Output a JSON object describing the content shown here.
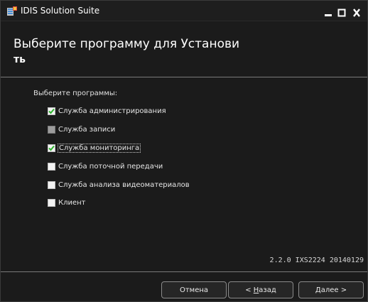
{
  "window": {
    "title": "IDIS Solution Suite",
    "controls": {
      "minimize": "minimize-icon",
      "maximize": "maximize-icon",
      "close": "close-icon"
    }
  },
  "header": {
    "line1": "Выберите программу для Установи",
    "line2": "ть"
  },
  "programs": {
    "label": "Выберите программы:",
    "items": [
      {
        "label": "Служба администрирования",
        "checked": true,
        "enabled": true
      },
      {
        "label": "Служба записи",
        "checked": false,
        "enabled": false
      },
      {
        "label": "Служба мониторинга",
        "checked": true,
        "enabled": true,
        "focused": true
      },
      {
        "label": "Служба поточной передачи",
        "checked": false,
        "enabled": true
      },
      {
        "label": "Служба анализа видеоматериалов",
        "checked": false,
        "enabled": true
      },
      {
        "label": "Клиент",
        "checked": false,
        "enabled": true
      }
    ]
  },
  "version": "2.2.0 IXS2224 20140129",
  "buttons": {
    "cancel": "Отмена",
    "back_prefix": "< ",
    "back_hotkey": "Н",
    "back_rest": "азад",
    "next_hotkey": "Д",
    "next_rest": "алее >"
  },
  "colors": {
    "check": "#2fb52f",
    "background": "#1b1b1b"
  }
}
